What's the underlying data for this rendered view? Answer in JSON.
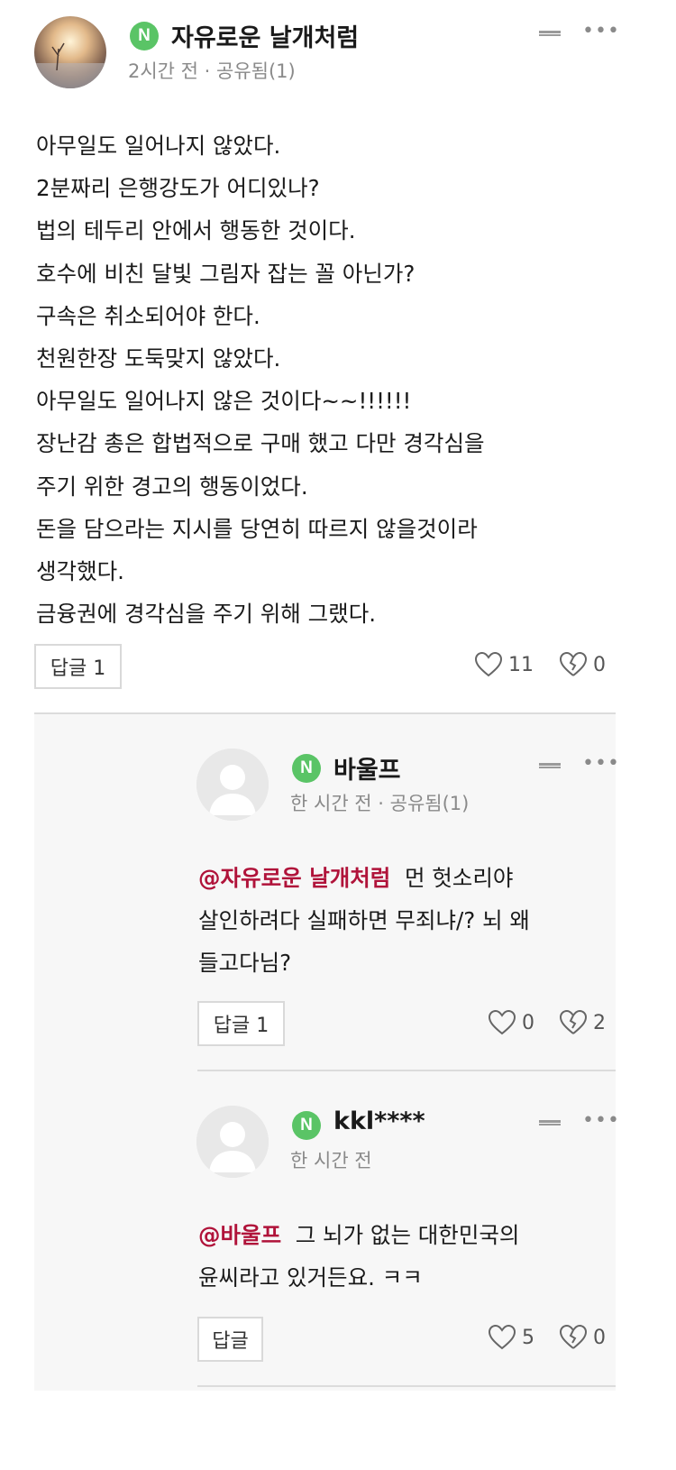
{
  "comment": {
    "nickname": "자유로운 날개처럼",
    "badge": "N",
    "meta": "2시간 전 · 공유됨(1)",
    "lines": [
      "아무일도 일어나지 않았다.",
      "2분짜리 은행강도가 어디있나?",
      "법의 테두리 안에서 행동한 것이다.",
      "호수에 비친 달빛 그림자 잡는 꼴 아닌가?",
      "구속은 취소되어야 한다.",
      "천원한장 도둑맞지 않았다.",
      "아무일도 일어나지 않은 것이다~~!!!!!!",
      "장난감 총은 합법적으로 구매 했고 다만 경각심을",
      "주기 위한 경고의 행동이었다.",
      "돈을 담으라는 지시를 당연히 따르지 않을것이라",
      "생각했다.",
      "금융권에 경각심을 주기 위해 그랬다."
    ],
    "reply_label": "답글 1",
    "likes": "11",
    "dislikes": "0"
  },
  "replies": [
    {
      "nickname": "바울프",
      "badge": "N",
      "meta": "한 시간 전 · 공유됨(1)",
      "mention": "@자유로운 날개처럼",
      "line1_rest": "먼 헛소리야",
      "line2": "살인하려다 실패하면 무죄냐/? 뇌 왜",
      "line3": "들고다님?",
      "reply_label": "답글 1",
      "likes": "0",
      "dislikes": "2"
    },
    {
      "nickname": "kkl****",
      "badge": "N",
      "meta": "한 시간 전",
      "mention": "@바울프",
      "line1_rest": "그 뇌가 없는 대한민국의",
      "line2": "윤씨라고 있거든요. ㅋㅋ",
      "reply_label": "답글",
      "likes": "5",
      "dislikes": "0"
    }
  ],
  "colors": {
    "badge": "#5ac466",
    "mention": "#b0133a",
    "thread_bg": "#f7f7f7"
  }
}
